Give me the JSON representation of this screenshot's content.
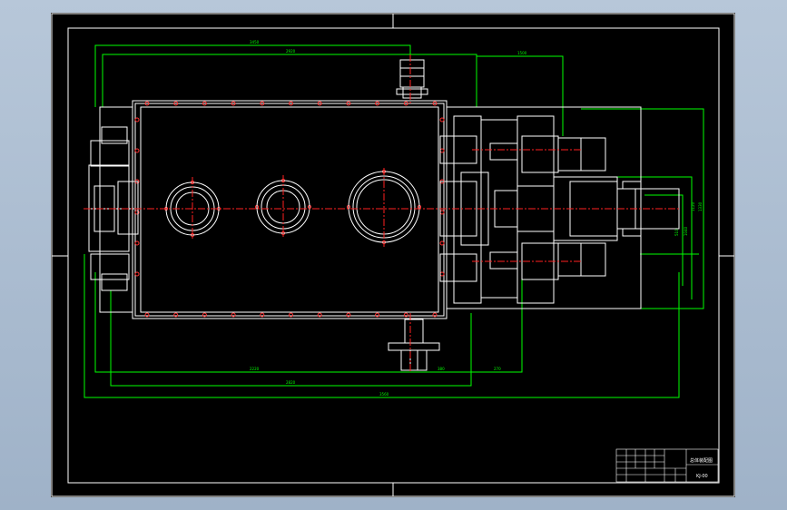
{
  "viewport": {
    "background": "#a9bace",
    "paper": "#000000"
  },
  "colors": {
    "outline": "#ffffff",
    "dimension": "#00ff00",
    "centerline": "#ff2020",
    "bolt": "#ff3030",
    "frame": "#ffffff"
  },
  "dimensions": {
    "top1": "3450",
    "top2": "2920",
    "top3": "1500",
    "bottom1": "2220",
    "bottom2": "380",
    "bottom3": "270",
    "bottom4": "2820",
    "bottom5": "3560",
    "right1": "510",
    "right2": "1040",
    "right3": "1120",
    "right4": "1330"
  },
  "title_block": {
    "drawing_title": "总体装配图",
    "drawing_number": "KJ-00"
  }
}
